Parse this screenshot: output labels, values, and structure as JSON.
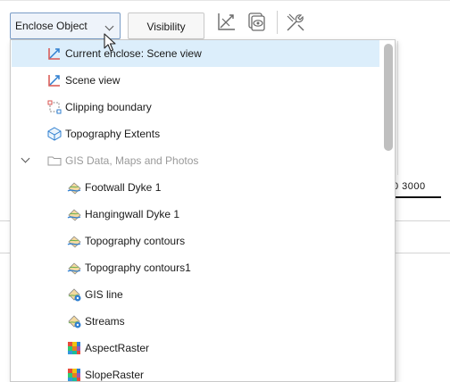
{
  "toolbar": {
    "enclose_dropdown_label": "Enclose Object",
    "visibility_label": "Visibility",
    "icons": [
      "axes-tool-icon",
      "view-filter-icon",
      "settings-tools-icon"
    ]
  },
  "background": {
    "scale_text": "0  3000"
  },
  "dropdown": {
    "items": [
      {
        "label": "Current enclose: Scene view",
        "icon": "enclose-arrow-icon",
        "selected": true,
        "disabled": false
      },
      {
        "label": "Scene view",
        "icon": "enclose-arrow-icon",
        "selected": false,
        "disabled": false
      },
      {
        "label": "Clipping boundary",
        "icon": "clipping-boundary-icon",
        "selected": false,
        "disabled": false
      },
      {
        "label": "Topography Extents",
        "icon": "topography-cube-icon",
        "selected": false,
        "disabled": false
      },
      {
        "label": "GIS Data, Maps and Photos",
        "icon": "folder-icon",
        "selected": false,
        "disabled": true,
        "expanded": true
      },
      {
        "label": "Footwall Dyke 1",
        "icon": "gis-lines-icon",
        "selected": false,
        "disabled": false
      },
      {
        "label": "Hangingwall Dyke 1",
        "icon": "gis-lines-icon",
        "selected": false,
        "disabled": false
      },
      {
        "label": "Topography contours",
        "icon": "gis-lines-icon",
        "selected": false,
        "disabled": false
      },
      {
        "label": "Topography contours1",
        "icon": "gis-lines-icon",
        "selected": false,
        "disabled": false
      },
      {
        "label": "GIS line",
        "icon": "gis-line-icon",
        "selected": false,
        "disabled": false
      },
      {
        "label": "Streams",
        "icon": "gis-line-icon",
        "selected": false,
        "disabled": false
      },
      {
        "label": "AspectRaster",
        "icon": "raster-icon",
        "selected": false,
        "disabled": false
      },
      {
        "label": "SlopeRaster",
        "icon": "raster-icon",
        "selected": false,
        "disabled": false
      }
    ]
  },
  "colors": {
    "selected_row": "#dceefb",
    "accent": "#2f7fd0",
    "disabled_text": "#9a9a9a"
  }
}
